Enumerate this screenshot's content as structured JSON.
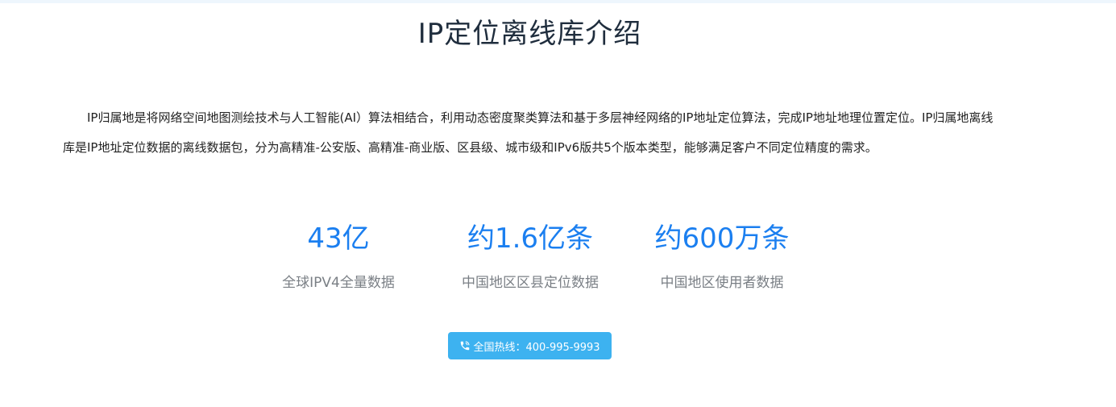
{
  "header": {
    "title": "IP定位离线库介绍"
  },
  "intro": {
    "text": "IP归属地是将网络空间地图测绘技术与人工智能(AI）算法相结合，利用动态密度聚类算法和基于多层神经网络的IP地址定位算法，完成IP地址地理位置定位。IP归属地离线库是IP地址定位数据的离线数据包，分为高精准-公安版、高精准-商业版、区县级、城市级和IPv6版共5个版本类型，能够满足客户不同定位精度的需求。"
  },
  "stats": [
    {
      "value": "43亿",
      "label": "全球IPV4全量数据"
    },
    {
      "value": "约1.6亿条",
      "label": "中国地区区县定位数据"
    },
    {
      "value": "约600万条",
      "label": "中国地区使用者数据"
    }
  ],
  "hotline": {
    "icon": "phone-icon",
    "label": "全国热线：400-995-9993"
  },
  "colors": {
    "accent": "#1b7ff0",
    "button": "#3db2f0",
    "title": "#1f2d3d",
    "muted": "#7a7f85"
  }
}
